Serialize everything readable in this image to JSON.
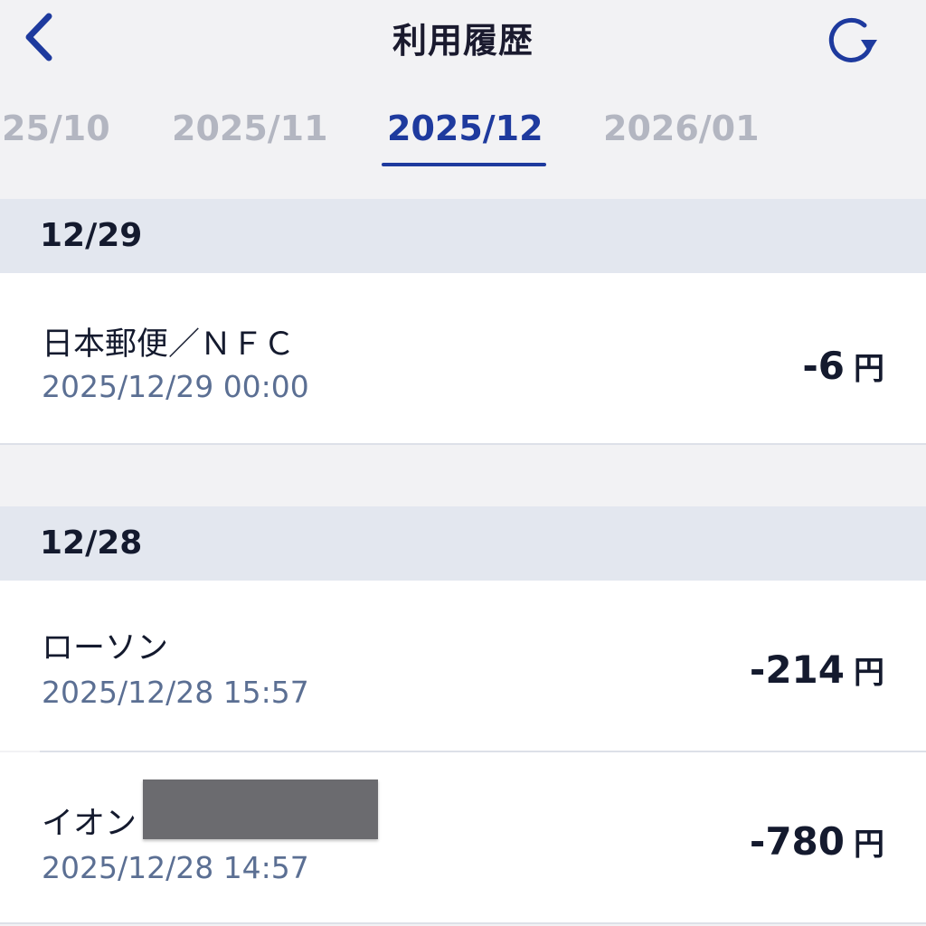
{
  "header": {
    "title": "利用履歴",
    "back_icon": "chevron-left-icon",
    "refresh_icon": "refresh-icon",
    "accent_color": "#1e3a9e"
  },
  "month_tabs": [
    {
      "label": "25/10",
      "active": false
    },
    {
      "label": "2025/11",
      "active": false
    },
    {
      "label": "2025/12",
      "active": true
    },
    {
      "label": "2026/01",
      "active": false
    }
  ],
  "sections": [
    {
      "date": "12/29",
      "transactions": [
        {
          "name": "日本郵便／ＮＦＣ",
          "datetime": "2025/12/29 00:00",
          "amount": "-6",
          "unit": "円"
        }
      ]
    },
    {
      "date": "12/28",
      "transactions": [
        {
          "name": "ローソン",
          "datetime": "2025/12/28 15:57",
          "amount": "-214",
          "unit": "円"
        },
        {
          "name": "イオン",
          "datetime": "2025/12/28 14:57",
          "amount": "-780",
          "unit": "円",
          "redacted": true
        }
      ]
    }
  ]
}
